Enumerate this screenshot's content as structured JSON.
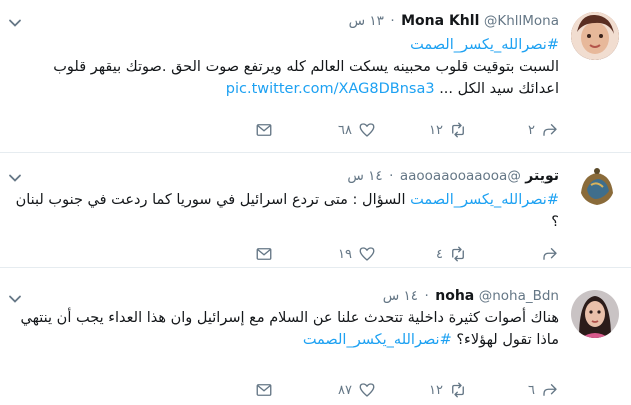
{
  "tweets": [
    {
      "name": "Mona Khll",
      "handle": "@KhllMona",
      "time": "١٣ س",
      "hashtag": "#نصرالله_يكسر_الصمت",
      "text": "السبت بتوقيت قلوب محبينه يسكت العالم كله ويرتفع صوت الحق .صوتك بيقهر قلوب اعدائك سيد الكل ...",
      "link": "pic.twitter.com/XAG8DBnsa3",
      "replies": "٢",
      "retweets": "١٢",
      "likes": "٦٨"
    },
    {
      "name": "تويتر",
      "handle": "@aaooaaooaaooa",
      "time": "١٤ س",
      "hashtag": "#نصرالله_يكسر_الصمت",
      "text": "السؤال : متى تردع اسرائيل في سوريا كما ردعت في جنوب لبنان ؟",
      "link": "",
      "replies": "",
      "retweets": "٤",
      "likes": "١٩"
    },
    {
      "name": "noha",
      "handle": "@noha_Bdn",
      "time": "١٤ س",
      "hashtag": "",
      "text": "هناك أصوات كثيرة داخلية تتحدث علنا عن السلام مع إسرائيل وان هذا العداء يجب أن ينتهي",
      "text2": "ماذا تقول لهؤلاء؟",
      "hashtag2": "#نصرالله_يكسر_الصمت",
      "replies": "٦",
      "retweets": "١٢",
      "likes": "٨٧"
    }
  ],
  "dot": "·",
  "icons": [
    "chevron-down-icon",
    "reply-icon",
    "retweet-icon",
    "heart-icon",
    "envelope-icon"
  ],
  "colors": {
    "accent": "#1da1f2",
    "muted": "#657786",
    "border": "#e6ecf0"
  }
}
